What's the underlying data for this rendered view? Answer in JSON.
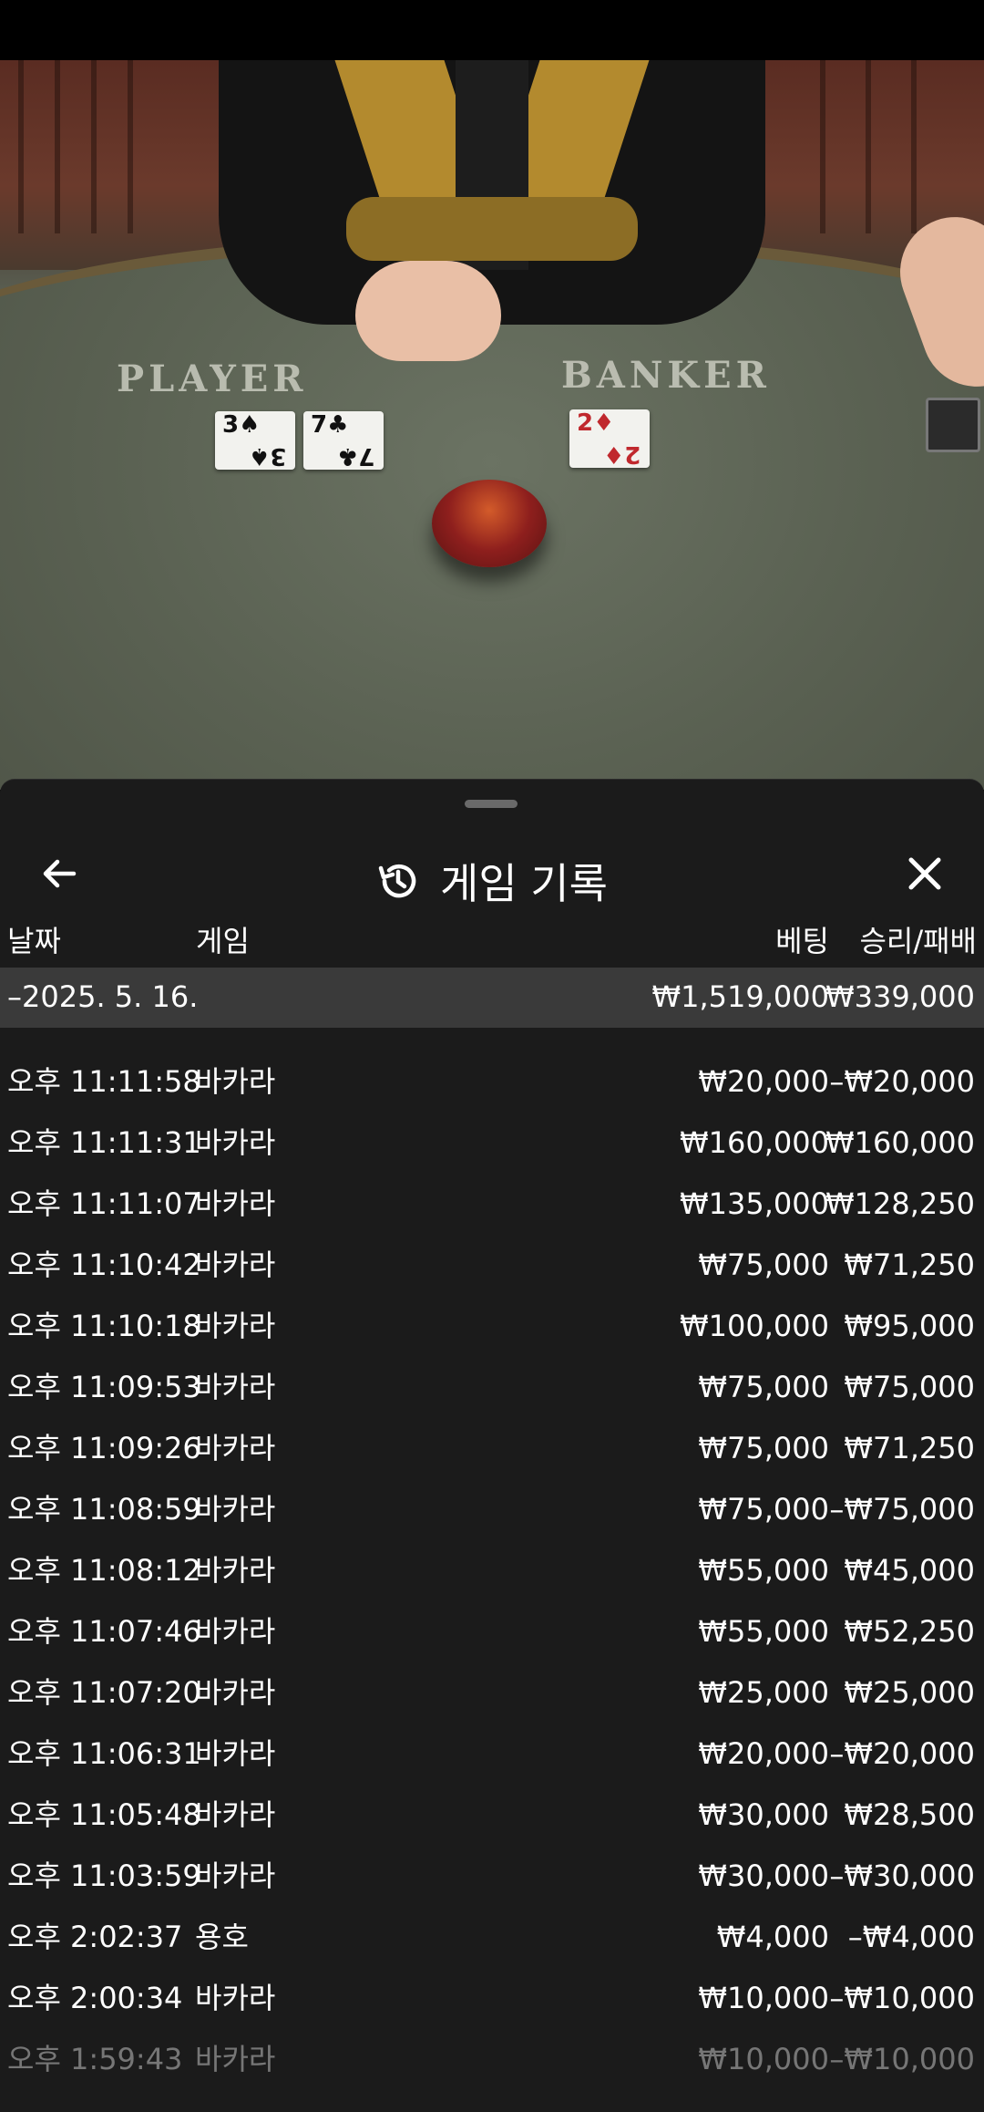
{
  "table": {
    "player_label": "PLAYER",
    "banker_label": "BANKER",
    "player_cards": [
      {
        "rank": "3",
        "suit": "♠",
        "color": "black"
      },
      {
        "rank": "7",
        "suit": "♣",
        "color": "black"
      }
    ],
    "banker_cards": [
      {
        "rank": "2",
        "suit": "♦",
        "color": "red"
      }
    ]
  },
  "sheet": {
    "title": "게임 기록",
    "columns": {
      "date": "날짜",
      "game": "게임",
      "bet": "베팅",
      "result": "승리/패배"
    },
    "date_group": {
      "date": "–2025. 5. 16.",
      "bet_total": "₩1,519,000",
      "result_total": "₩339,000"
    },
    "rows": [
      {
        "time": "오후 11:11:58",
        "game": "바카라",
        "bet": "₩20,000",
        "result": "–₩20,000"
      },
      {
        "time": "오후 11:11:31",
        "game": "바카라",
        "bet": "₩160,000",
        "result": "₩160,000"
      },
      {
        "time": "오후 11:11:07",
        "game": "바카라",
        "bet": "₩135,000",
        "result": "₩128,250"
      },
      {
        "time": "오후 11:10:42",
        "game": "바카라",
        "bet": "₩75,000",
        "result": "₩71,250"
      },
      {
        "time": "오후 11:10:18",
        "game": "바카라",
        "bet": "₩100,000",
        "result": "₩95,000"
      },
      {
        "time": "오후 11:09:53",
        "game": "바카라",
        "bet": "₩75,000",
        "result": "₩75,000"
      },
      {
        "time": "오후 11:09:26",
        "game": "바카라",
        "bet": "₩75,000",
        "result": "₩71,250"
      },
      {
        "time": "오후 11:08:59",
        "game": "바카라",
        "bet": "₩75,000",
        "result": "–₩75,000"
      },
      {
        "time": "오후 11:08:12",
        "game": "바카라",
        "bet": "₩55,000",
        "result": "₩45,000"
      },
      {
        "time": "오후 11:07:46",
        "game": "바카라",
        "bet": "₩55,000",
        "result": "₩52,250"
      },
      {
        "time": "오후 11:07:20",
        "game": "바카라",
        "bet": "₩25,000",
        "result": "₩25,000"
      },
      {
        "time": "오후 11:06:31",
        "game": "바카라",
        "bet": "₩20,000",
        "result": "–₩20,000"
      },
      {
        "time": "오후 11:05:48",
        "game": "바카라",
        "bet": "₩30,000",
        "result": "₩28,500"
      },
      {
        "time": "오후 11:03:59",
        "game": "바카라",
        "bet": "₩30,000",
        "result": "–₩30,000"
      },
      {
        "time": "오후 2:02:37",
        "game": "용호",
        "bet": "₩4,000",
        "result": "–₩4,000"
      },
      {
        "time": "오후 2:00:34",
        "game": "바카라",
        "bet": "₩10,000",
        "result": "–₩10,000"
      },
      {
        "time": "오후 1:59:43",
        "game": "바카라",
        "bet": "₩10,000",
        "result": "–₩10,000"
      }
    ]
  },
  "icons": {
    "back": "arrow-left-icon",
    "close": "close-icon",
    "history": "history-icon"
  }
}
